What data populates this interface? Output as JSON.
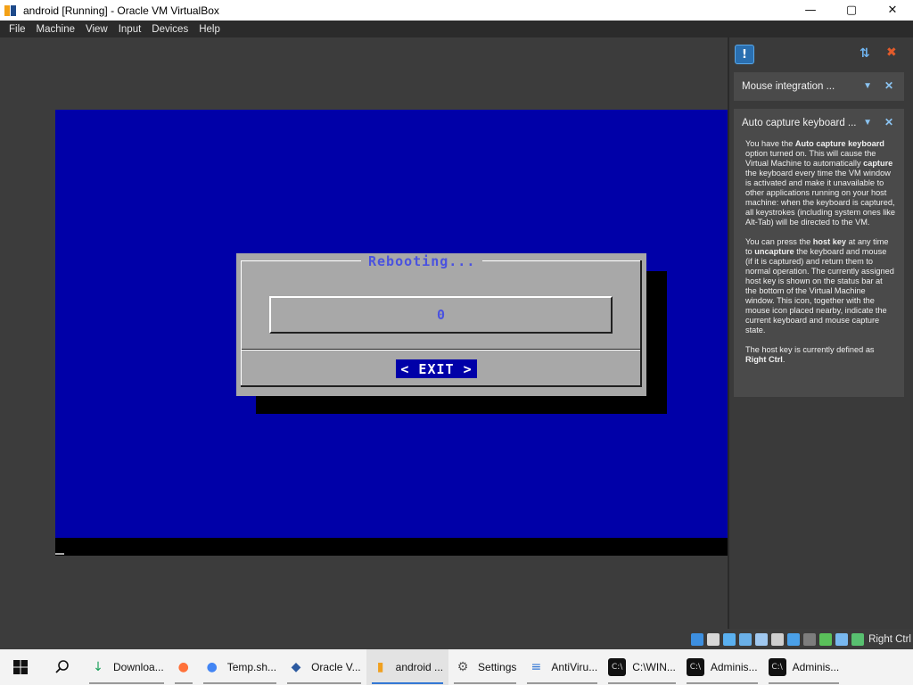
{
  "window": {
    "title": "android [Running] - Oracle VM VirtualBox",
    "controls": {
      "minimize": "—",
      "maximize": "▢",
      "close": "✕"
    }
  },
  "menu": [
    "File",
    "Machine",
    "View",
    "Input",
    "Devices",
    "Help"
  ],
  "guest": {
    "dialog_title": "Rebooting...",
    "gauge_value": "0",
    "exit_button": "< EXIT >"
  },
  "notifications": [
    {
      "title": "Mouse integration ..."
    },
    {
      "title": "Auto capture keyboard ...",
      "body": {
        "p1": [
          "You have the ",
          "Auto capture keyboard",
          " option turned on. This will cause the Virtual Machine to automatically ",
          "capture",
          " the keyboard every time the VM window is activated and make it unavailable to other applications running on your host machine: when the keyboard is captured, all keystrokes (including system ones like Alt-Tab) will be directed to the VM."
        ],
        "p2": [
          "You can press the ",
          "host key",
          " at any time to ",
          "uncapture",
          " the keyboard and mouse (if it is captured) and return them to normal operation. The currently assigned host key is shown on the status bar at the bottom of the Virtual Machine window. This icon, together with the mouse icon placed nearby, indicate the current keyboard and mouse capture state."
        ],
        "p3": [
          "The host key is currently defined as ",
          "Right Ctrl",
          "."
        ]
      }
    }
  ],
  "statusbar": {
    "host_key": "Right Ctrl",
    "icons": [
      "hard-disk-icon",
      "optical-drive-icon",
      "audio-icon",
      "network-icon",
      "usb-icon",
      "shared-folders-icon",
      "display-icon",
      "video-capture-icon",
      "cpu-icon",
      "mouse-integration-icon",
      "keyboard-capture-icon"
    ],
    "icon_colors": [
      "#3d8fe0",
      "#d8d8d8",
      "#5ab0f0",
      "#6ab0e8",
      "#a0c8f0",
      "#cfcfcf",
      "#4aa0e8",
      "#7d7d7d",
      "#5ac05a",
      "#78b8ef",
      "#58c070"
    ]
  },
  "taskbar": [
    {
      "label": "Downloa...",
      "icon": "download-icon",
      "color": "#1aa05a",
      "active": false
    },
    {
      "label": "",
      "icon": "firefox-icon",
      "color": "#ff7139",
      "active": false
    },
    {
      "label": "Temp.sh...",
      "icon": "chrome-icon",
      "color": "#4285f4",
      "active": false
    },
    {
      "label": "Oracle V...",
      "icon": "virtualbox-icon",
      "color": "#2c5aa0",
      "active": false
    },
    {
      "label": "android ...",
      "icon": "virtualbox-vm-icon",
      "color": "#f0a020",
      "active": true
    },
    {
      "label": "Settings",
      "icon": "settings-icon",
      "color": "#555555",
      "active": false
    },
    {
      "label": "AntiViru...",
      "icon": "notepad-icon",
      "color": "#3478d4",
      "active": false
    },
    {
      "label": "C:\\WIN...",
      "icon": "cmd-icon",
      "color": "#111111",
      "active": false
    },
    {
      "label": "Adminis...",
      "icon": "cmd-icon",
      "color": "#111111",
      "active": false
    },
    {
      "label": "Adminis...",
      "icon": "cmd-icon",
      "color": "#111111",
      "active": false
    }
  ]
}
